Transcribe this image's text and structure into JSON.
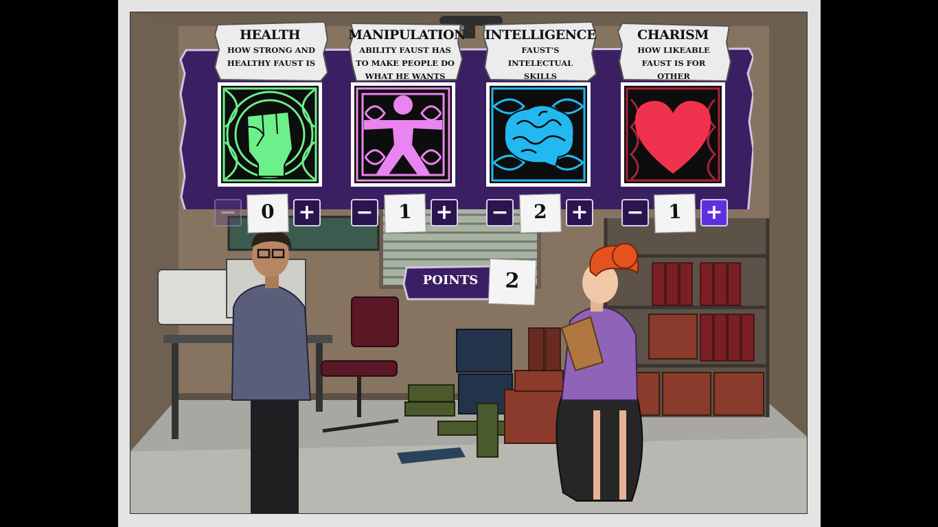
{
  "stats": [
    {
      "title": "HEALTH",
      "description": "HOW STRONG AND HEALTHY FAUST IS",
      "icon": "fist-icon",
      "value": "0",
      "minus": "−",
      "plus": "+",
      "color": "#6cf08a",
      "minus_state": "disabled",
      "plus_state": "normal"
    },
    {
      "title": "MANIPULATION",
      "description": "ABILITY FAUST HAS TO MAKE PEOPLE DO WHAT HE WANTS",
      "icon": "human-figure-icon",
      "value": "1",
      "minus": "−",
      "plus": "+",
      "color": "#ea84f0",
      "minus_state": "normal",
      "plus_state": "normal"
    },
    {
      "title": "INTELLIGENCE",
      "description": "FAUST'S INTELECTUAL SKILLS",
      "icon": "brain-icon",
      "value": "2",
      "minus": "−",
      "plus": "+",
      "color": "#22b8f0",
      "minus_state": "normal",
      "plus_state": "normal"
    },
    {
      "title": "CHARISM",
      "description": "HOW LIKEABLE FAUST IS FOR OTHER CHARACTERS",
      "icon": "heart-icon",
      "value": "1",
      "minus": "−",
      "plus": "+",
      "color": "#f0324e",
      "minus_state": "normal",
      "plus_state": "highlighted"
    }
  ],
  "points": {
    "label": "POINTS",
    "value": "2"
  },
  "colors": {
    "banner": "#3a1f63",
    "panel_border": "#cfc6e2",
    "button": "#2b1550",
    "button_highlight": "#5e2fe0"
  }
}
